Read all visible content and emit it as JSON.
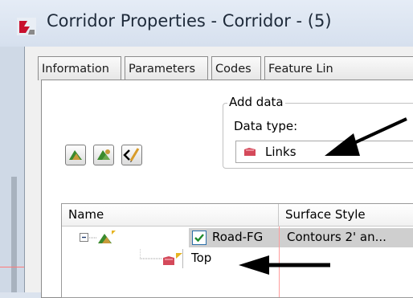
{
  "window": {
    "title": "Corridor Properties - Corridor - (5)"
  },
  "tabs": [
    {
      "label": "Information"
    },
    {
      "label": "Parameters"
    },
    {
      "label": "Codes"
    },
    {
      "label": "Feature Lin"
    }
  ],
  "add_data": {
    "group_label": "Add data",
    "data_type_label": "Data type:",
    "data_type_value": "Links"
  },
  "toolbar": {
    "icons": [
      "add-surface-icon",
      "add-surface-alt-icon",
      "edit-code-icon"
    ]
  },
  "grid": {
    "columns": [
      "Name",
      "Surface Style"
    ],
    "rows": [
      {
        "name": "Road-FG",
        "surface_style": "Contours 2' an...",
        "checked": true
      },
      {
        "name": "Top",
        "surface_style": ""
      }
    ]
  },
  "colors": {
    "arrow": "#000000",
    "selection": "#cfcfcf",
    "checkbox_border": "#2a6ea8"
  }
}
